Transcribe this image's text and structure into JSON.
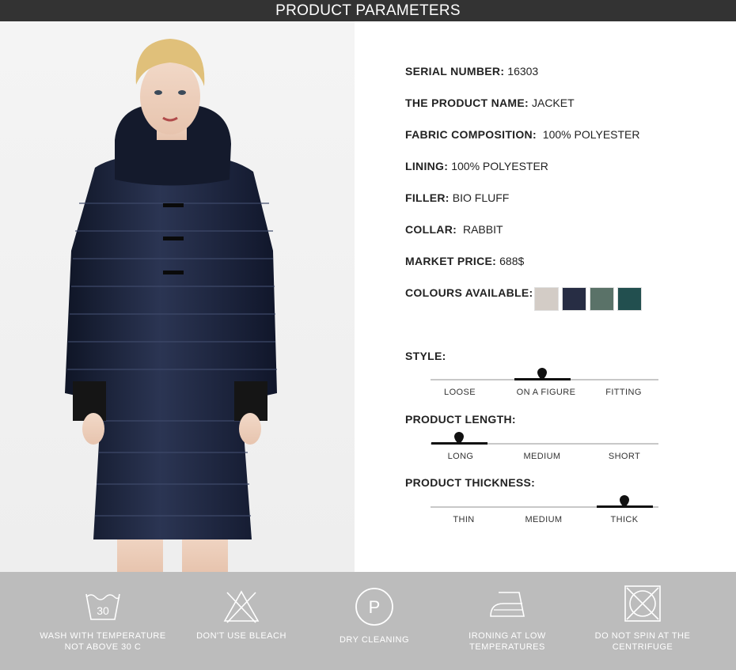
{
  "header": {
    "title": "PRODUCT PARAMETERS"
  },
  "product_image": {
    "alt": "Woman wearing long navy quilted down jacket with rabbit fur hood"
  },
  "params": [
    {
      "label": "SERIAL NUMBER:",
      "value": "16303"
    },
    {
      "label": "THE PRODUCT NAME:",
      "value": "JACKET"
    },
    {
      "label": "FABRIC COMPOSITION:",
      "value": " 100% POLYESTER"
    },
    {
      "label": "LINING:",
      "value": "100% POLYESTER"
    },
    {
      "label": "FILLER:",
      "value": "BIO FLUFF"
    },
    {
      "label": "COLLAR:",
      "value": " RABBIT"
    },
    {
      "label": "MARKET PRICE:",
      "value": "688$"
    },
    {
      "label": "COLOURS AVAILABLE:",
      "value": ""
    }
  ],
  "colours": [
    "#d3ccc6",
    "#272d44",
    "#5a7268",
    "#224f4f"
  ],
  "style": {
    "label": "STYLE:",
    "options": [
      "LOOSE",
      "ON A FIGURE",
      "FITTING"
    ],
    "selected": "ON A FIGURE"
  },
  "length": {
    "label": "PRODUCT LENGTH:",
    "options": [
      "LONG",
      "MEDIUM",
      "SHORT"
    ],
    "selected": "LONG"
  },
  "thickness": {
    "label": "PRODUCT THICKNESS:",
    "options": [
      "THIN",
      "MEDIUM",
      "THICK"
    ],
    "selected": "THICK"
  },
  "care": [
    {
      "icon": "wash-30-icon",
      "temp": "30",
      "label": "WASH WITH TEMPERATURE NOT ABOVE 30 C"
    },
    {
      "icon": "no-bleach-icon",
      "label": "DON'T USE BLEACH"
    },
    {
      "icon": "dry-clean-icon",
      "letter": "P",
      "label": "DRY CLEANING"
    },
    {
      "icon": "iron-low-icon",
      "label": "IRONING AT LOW TEMPERATURES"
    },
    {
      "icon": "no-spin-icon",
      "label": "DO NOT SPIN AT THE CENTRIFUGE"
    }
  ]
}
